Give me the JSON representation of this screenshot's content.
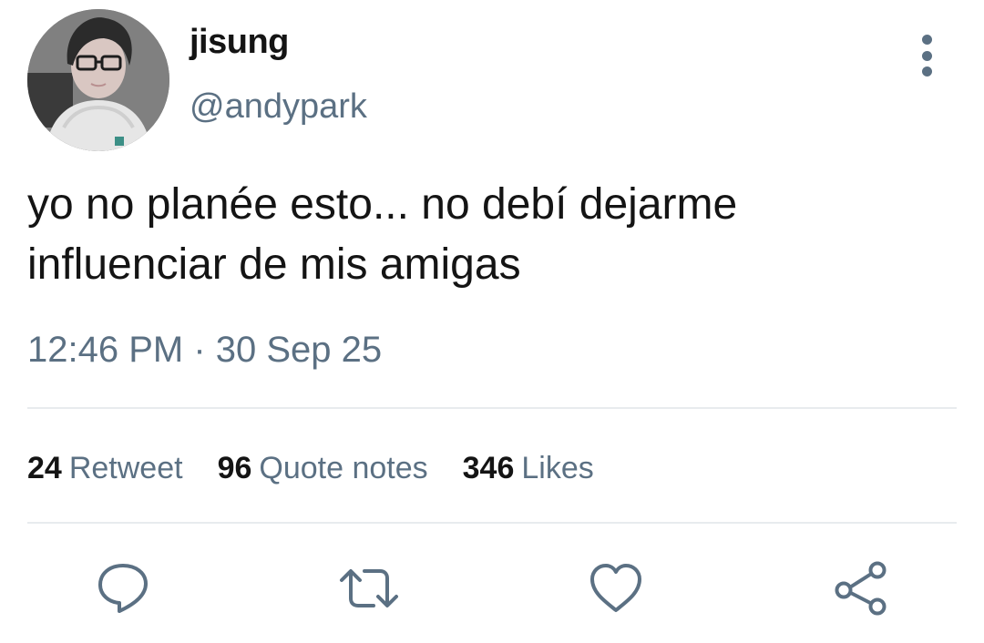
{
  "author": {
    "display_name": "jisung",
    "handle": "@andypark",
    "avatar": "profile-photo"
  },
  "menu_icon": "more-vertical-icon",
  "tweet": {
    "text_line1": "yo no planée esto... no debí dejarme",
    "text_line2": "influenciar de mis amigas",
    "timestamp": "12:46 PM · 30 Sep 25"
  },
  "stats": [
    {
      "count": "24",
      "label": "Retweet"
    },
    {
      "count": "96",
      "label": "Quote notes"
    },
    {
      "count": "346",
      "label": "Likes"
    }
  ],
  "actions": [
    {
      "icon": "reply-icon"
    },
    {
      "icon": "retweet-icon"
    },
    {
      "icon": "like-icon"
    },
    {
      "icon": "share-icon"
    }
  ],
  "colors": {
    "text": "#141414",
    "secondary": "#5b7083",
    "divider": "#e8ebee"
  }
}
